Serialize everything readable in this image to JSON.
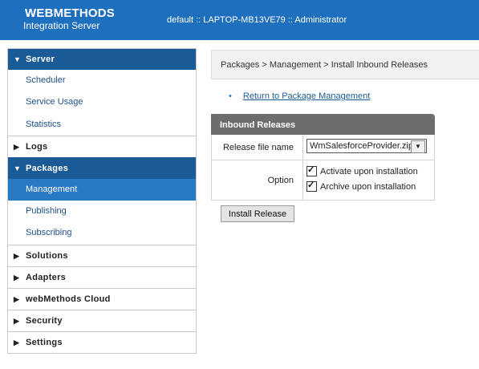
{
  "header": {
    "brand_line1": "WEBMETHODS",
    "brand_line2": "Integration Server",
    "context": "default :: LAPTOP-MB13VE79 :: Administrator"
  },
  "sidebar": {
    "sections": [
      {
        "label": "Server",
        "open": true,
        "items": [
          "Scheduler",
          "Service Usage",
          "Statistics"
        ]
      },
      {
        "label": "Logs",
        "open": false
      },
      {
        "label": "Packages",
        "open": true,
        "items": [
          "Management",
          "Publishing",
          "Subscribing"
        ],
        "active_item": "Management"
      },
      {
        "label": "Solutions",
        "open": false
      },
      {
        "label": "Adapters",
        "open": false
      },
      {
        "label": "webMethods Cloud",
        "open": false
      },
      {
        "label": "Security",
        "open": false
      },
      {
        "label": "Settings",
        "open": false
      }
    ]
  },
  "breadcrumb": "Packages > Management > Install Inbound Releases",
  "return_link": "Return to Package Management",
  "panel": {
    "title": "Inbound Releases",
    "release_label": "Release file name",
    "release_value": "WmSalesforceProvider.zip",
    "option_label": "Option",
    "options": [
      "Activate upon installation",
      "Archive upon installation"
    ]
  },
  "install_button": "Install Release",
  "colors": {
    "header": "#1f6fbf",
    "section_open": "#1a5a96",
    "active_item": "#2a79c5",
    "panel_head": "#6d6d6d"
  }
}
